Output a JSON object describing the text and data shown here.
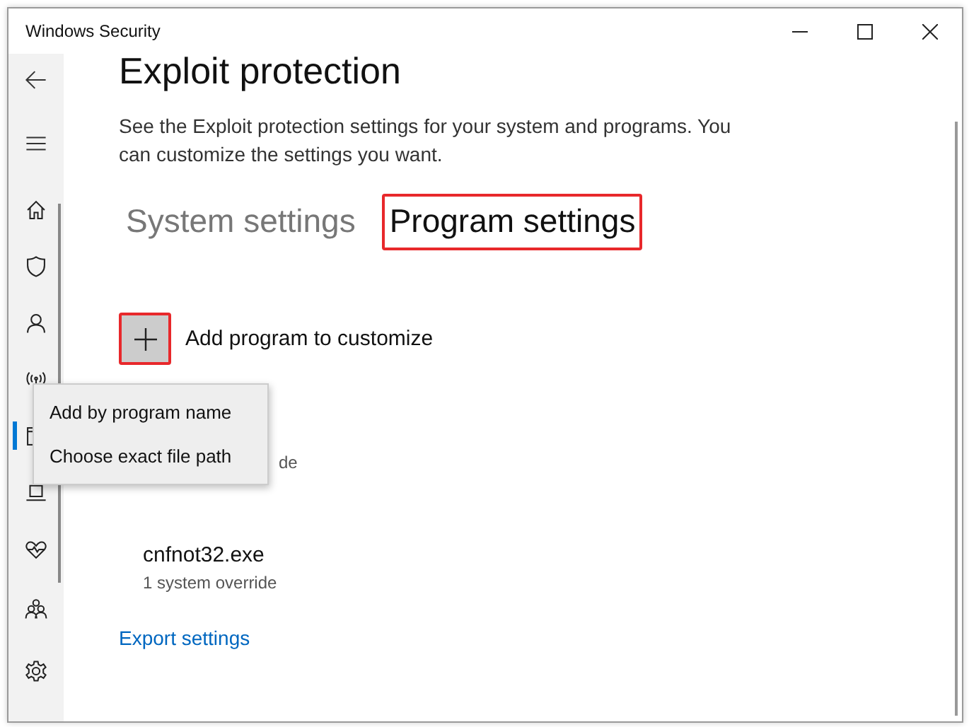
{
  "window": {
    "title": "Windows Security"
  },
  "sidebar": {
    "items": [
      {
        "selected": false
      },
      {
        "selected": false
      },
      {
        "selected": false
      },
      {
        "selected": false
      },
      {
        "selected": true
      },
      {
        "selected": false
      },
      {
        "selected": false
      },
      {
        "selected": false
      },
      {
        "selected": false
      }
    ]
  },
  "page": {
    "title": "Exploit protection",
    "description": "See the Exploit protection settings for your system and programs.  You can customize the settings you want."
  },
  "tabs": [
    {
      "label": "System settings",
      "selected": false,
      "highlighted": false
    },
    {
      "label": "Program settings",
      "selected": true,
      "highlighted": true
    }
  ],
  "add_button": {
    "label": "Add program to customize",
    "highlighted": true
  },
  "menu": {
    "items": [
      "Add by program name",
      "Choose exact file path"
    ]
  },
  "programs": [
    {
      "detail": "de"
    },
    {
      "name": "cnfnot32.exe",
      "detail": "1 system override"
    }
  ],
  "export_link": "Export settings"
}
